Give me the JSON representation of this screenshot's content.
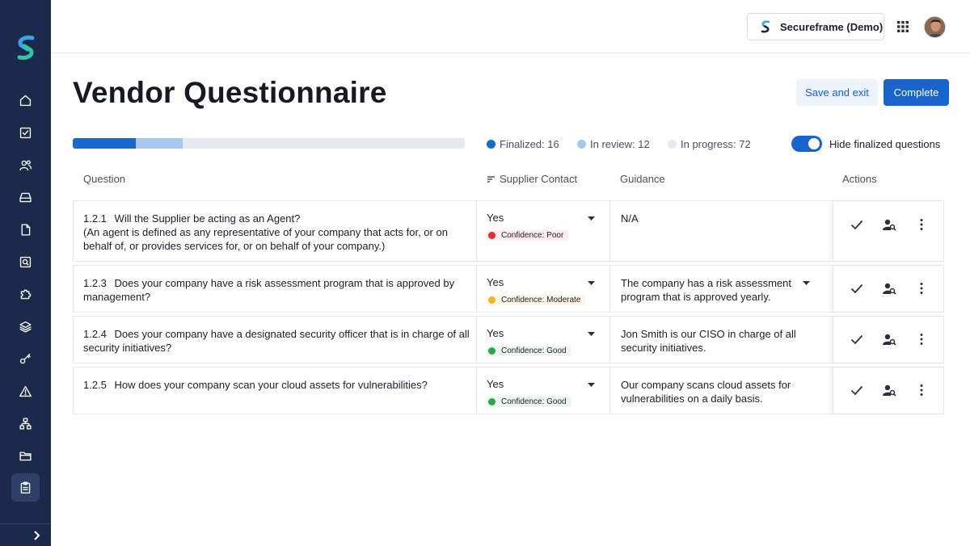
{
  "brand": {
    "org_button": "Secureframe (Demo)"
  },
  "page": {
    "title": "Vendor Questionnaire"
  },
  "actions": {
    "save_label": "Save and exit",
    "complete_label": "Complete"
  },
  "progress": {
    "finalized": 16,
    "in_review": 12,
    "in_progress": 72,
    "finalized_label": "Finalized: 16",
    "in_review_label": "In review: 12",
    "in_progress_label": "In progress: 72",
    "colors": {
      "finalized": "#1868d0",
      "in_review": "#a6c8ee",
      "in_progress": "#e5e9f0"
    }
  },
  "toggle": {
    "label": "Hide finalized questions",
    "on": true
  },
  "table": {
    "headers": {
      "question": "Question",
      "supplier": "Supplier Contact",
      "guidance": "Guidance",
      "actions": "Actions"
    },
    "rows": [
      {
        "number": "1.2.1",
        "question": "Will the Supplier be acting as an Agent?",
        "question_note": "(An agent is defined as any representative of your company that acts for, or on behalf of, or provides services for, or on behalf of your company.)",
        "answer": "Yes",
        "confidence": "Confidence: Poor",
        "confidence_level": "poor",
        "guidance": "N/A",
        "guidance_dropdown": false
      },
      {
        "number": "1.2.3",
        "question": "Does your company have a risk assessment program that is approved by management?",
        "question_note": "",
        "answer": "Yes",
        "confidence": "Confidence: Moderate",
        "confidence_level": "moderate",
        "guidance": "The company has a risk assessment program that is approved yearly.",
        "guidance_dropdown": true
      },
      {
        "number": "1.2.4",
        "question": "Does your company have a designated security officer that is in charge of all security initiatives?",
        "question_note": "",
        "answer": "Yes",
        "confidence": "Confidence: Good",
        "confidence_level": "good",
        "guidance": "Jon Smith is our CISO in charge of all security initiatives.",
        "guidance_dropdown": false
      },
      {
        "number": "1.2.5",
        "question": "How does your company scan your cloud assets for vulnerabilities?",
        "question_note": "",
        "answer": "Yes",
        "confidence": "Confidence: Good",
        "confidence_level": "good",
        "guidance": "Our company scans cloud assets for vulnerabilities on a daily basis.",
        "guidance_dropdown": false
      }
    ]
  },
  "colors": {
    "sidebar": "#1b2a4a",
    "accent": "#1765cc",
    "poor": "#e0312e",
    "moderate": "#f1b522",
    "good": "#2aa84a"
  },
  "icons": [
    "logo",
    "home-icon",
    "checkbox-icon",
    "users-icon",
    "inbox-icon",
    "document-icon",
    "search-doc-icon",
    "puzzle-icon",
    "layers-icon",
    "key-icon",
    "warning-icon",
    "sitemap-icon",
    "folder-icon",
    "clipboard-icon",
    "chevron-right-icon",
    "apps-grid-icon",
    "check-icon",
    "assign-user-icon",
    "more-vertical-icon"
  ]
}
